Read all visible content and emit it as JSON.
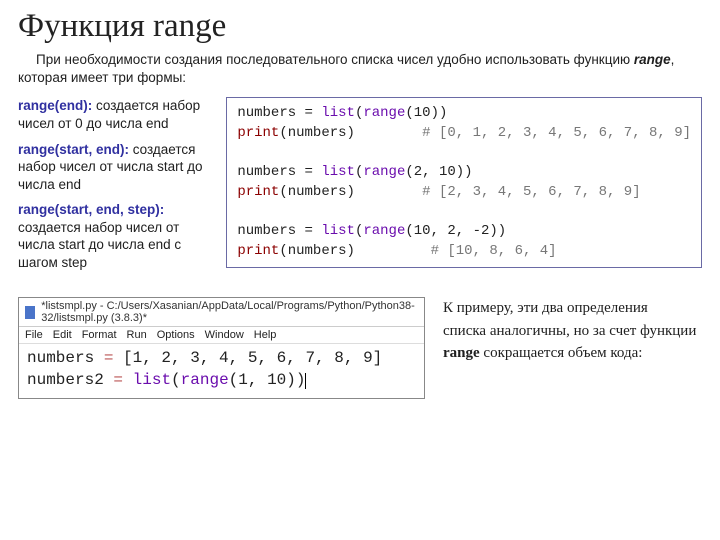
{
  "title": "Функция range",
  "intro": {
    "before": "При необходимости создания последовательного списка чисел удобно использовать функцию ",
    "bold": "range",
    "after": ", которая имеет три формы:"
  },
  "defs": [
    {
      "sig": "range(end):",
      "desc": " создается набор чисел от 0 до числа end"
    },
    {
      "sig": "range(start, end):",
      "desc": " создается набор чисел от числа start до числа end"
    },
    {
      "sig": "range(start, end, step):",
      "desc": " создается набор чисел от числа start до числа end с шагом step"
    }
  ],
  "code": {
    "l1a": "numbers = ",
    "l1b": "list",
    "l1c": "(",
    "l1d": "range",
    "l1e": "(10))",
    "l2a": "print",
    "l2b": "(numbers)        ",
    "l2c": "# [0, 1, 2, 3, 4, 5, 6, 7, 8, 9]",
    "blank1": "",
    "l3a": "numbers = ",
    "l3b": "list",
    "l3c": "(",
    "l3d": "range",
    "l3e": "(2, 10))",
    "l4a": "print",
    "l4b": "(numbers)        ",
    "l4c": "# [2, 3, 4, 5, 6, 7, 8, 9]",
    "blank2": "",
    "l5a": "numbers = ",
    "l5b": "list",
    "l5c": "(",
    "l5d": "range",
    "l5e": "(10, 2, -2))",
    "l6a": "print",
    "l6b": "(numbers)         ",
    "l6c": "# [10, 8, 6, 4]"
  },
  "editor": {
    "title": "*listsmpl.py - C:/Users/Xasanian/AppData/Local/Programs/Python/Python38-32/listsmpl.py (3.8.3)*",
    "menu": [
      "File",
      "Edit",
      "Format",
      "Run",
      "Options",
      "Window",
      "Help"
    ],
    "line1": {
      "a": "numbers ",
      "eq": "=",
      "b": " [1, 2, 3, 4, 5, 6, 7, 8, 9]"
    },
    "line2": {
      "a": "numbers2 ",
      "eq": "=",
      "b": " ",
      "func1": "list",
      "c": "(",
      "func2": "range",
      "d": "(1, 10))"
    }
  },
  "aside": {
    "p1": "К примеру, эти два определения",
    "p2a": "списка аналогичны, но за счет функции ",
    "p2b": "range",
    "p2c": " сокращается объем кода:"
  }
}
